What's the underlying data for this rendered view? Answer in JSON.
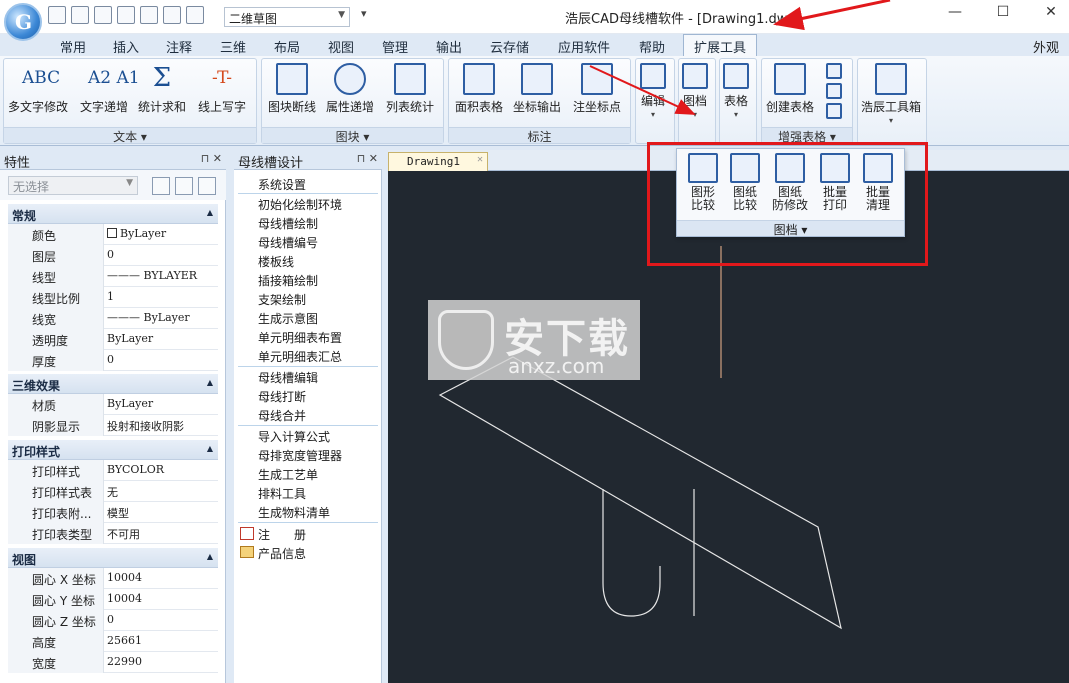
{
  "title_bar": {
    "workspace": "二维草图",
    "window_title": "浩辰CAD母线槽软件 - [Drawing1.dwg]",
    "logo_letter": "G"
  },
  "menu_tabs": [
    "常用",
    "插入",
    "注释",
    "三维",
    "布局",
    "视图",
    "管理",
    "输出",
    "云存储",
    "应用软件",
    "帮助",
    "扩展工具"
  ],
  "active_tab": "扩展工具",
  "appearance_label": "外观",
  "ribbon": {
    "text_group": {
      "label": "文本",
      "buttons": [
        "多文字修改",
        "文字递增",
        "统计求和",
        "线上写字"
      ],
      "icons": [
        "ABC",
        "A2 A1",
        "Σ",
        "-T-"
      ]
    },
    "block_group": {
      "label": "图块",
      "buttons": [
        "图块断线",
        "属性递增",
        "列表统计"
      ]
    },
    "annotation_group": {
      "label": "标注",
      "buttons": [
        "面积表格",
        "坐标输出",
        "注坐标点"
      ]
    },
    "edit_label": "编辑",
    "archive_label": "图档",
    "table_label": "表格",
    "enhanced_table_group": {
      "label": "增强表格",
      "buttons": [
        "创建表格"
      ]
    },
    "toolbox_label": "浩辰工具箱"
  },
  "archive_popup": {
    "label": "图档",
    "buttons": [
      "图形比较",
      "图纸比较",
      "图纸防修改",
      "批量打印",
      "批量清理"
    ],
    "lines": [
      [
        "图形",
        "比较"
      ],
      [
        "图纸",
        "比较"
      ],
      [
        "图纸",
        "防修改"
      ],
      [
        "批量",
        "打印"
      ],
      [
        "批量",
        "清理"
      ]
    ]
  },
  "properties_panel": {
    "title": "特性",
    "selection": "无选择",
    "sections": [
      {
        "title": "常规",
        "rows": [
          {
            "key": "颜色",
            "value": "ByLayer"
          },
          {
            "key": "图层",
            "value": "0"
          },
          {
            "key": "线型",
            "value": "BYLAYER"
          },
          {
            "key": "线型比例",
            "value": "1"
          },
          {
            "key": "线宽",
            "value": "ByLayer"
          },
          {
            "key": "透明度",
            "value": "ByLayer"
          },
          {
            "key": "厚度",
            "value": "0"
          }
        ]
      },
      {
        "title": "三维效果",
        "rows": [
          {
            "key": "材质",
            "value": "ByLayer"
          },
          {
            "key": "阴影显示",
            "value": "投射和接收阴影"
          }
        ]
      },
      {
        "title": "打印样式",
        "rows": [
          {
            "key": "打印样式",
            "value": "BYCOLOR"
          },
          {
            "key": "打印样式表",
            "value": "无"
          },
          {
            "key": "打印表附...",
            "value": "模型"
          },
          {
            "key": "打印表类型",
            "value": "不可用"
          }
        ]
      },
      {
        "title": "视图",
        "rows": [
          {
            "key": "圆心 X 坐标",
            "value": "10004"
          },
          {
            "key": "圆心 Y 坐标",
            "value": "10004"
          },
          {
            "key": "圆心 Z 坐标",
            "value": "0"
          },
          {
            "key": "高度",
            "value": "25661"
          },
          {
            "key": "宽度",
            "value": "22990"
          }
        ]
      }
    ]
  },
  "design_panel": {
    "title": "母线槽设计",
    "groups": [
      [
        "系统设置"
      ],
      [
        "初始化绘制环境",
        "母线槽绘制",
        "母线槽编号",
        "楼板线",
        "插接箱绘制",
        "支架绘制",
        "生成示意图",
        "单元明细表布置",
        "单元明细表汇总"
      ],
      [
        "母线槽编辑",
        "母线打断",
        "母线合并"
      ],
      [
        "导入计算公式",
        "母排宽度管理器",
        "生成工艺单",
        "排料工具",
        "生成物料清单"
      ],
      [
        "注　　册",
        "产品信息"
      ]
    ]
  },
  "document": {
    "tab": "Drawing1"
  },
  "watermark": {
    "text": "安下载",
    "url": "anxz.com"
  },
  "colors": {
    "canvas": "#212830",
    "annotation_red": "#e1181b",
    "ribbon_bg": "#e4edf7"
  }
}
